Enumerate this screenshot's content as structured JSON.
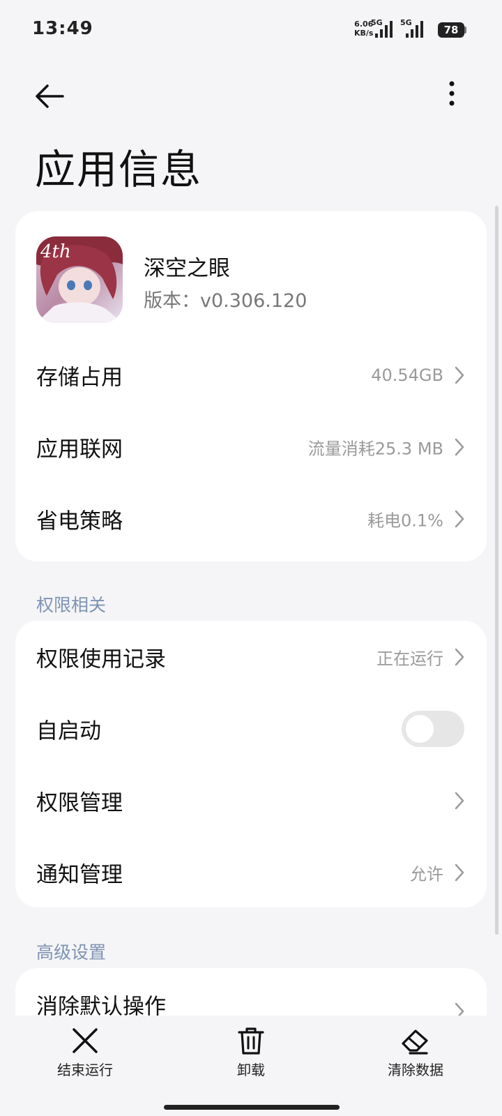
{
  "status_bar": {
    "time": "13:49",
    "net_speed_value": "6.06",
    "net_speed_unit": "KB/s",
    "sim1_label": "5G",
    "sim2_label": "5G",
    "battery": "78"
  },
  "header": {
    "title": "应用信息",
    "back_icon": "arrow-left-icon",
    "more_icon": "more-vertical-icon"
  },
  "app": {
    "name": "深空之眼",
    "version": "版本：v0.306.120",
    "icon_badge": "4th"
  },
  "info_rows": [
    {
      "label": "存储占用",
      "value": "40.54GB"
    },
    {
      "label": "应用联网",
      "value": "流量消耗25.3 MB"
    },
    {
      "label": "省电策略",
      "value": "耗电0.1%"
    }
  ],
  "permissions_section": {
    "title": "权限相关",
    "rows": [
      {
        "label": "权限使用记录",
        "value": "正在运行"
      },
      {
        "label": "自启动",
        "toggle_on": false
      },
      {
        "label": "权限管理",
        "value": ""
      },
      {
        "label": "通知管理",
        "value": "允许"
      }
    ]
  },
  "advanced_section": {
    "title": "高级设置",
    "rows": [
      {
        "label": "消除默认操作"
      }
    ]
  },
  "bottom_actions": [
    {
      "label": "结束运行",
      "icon": "close-icon"
    },
    {
      "label": "卸载",
      "icon": "trash-icon"
    },
    {
      "label": "清除数据",
      "icon": "eraser-icon"
    }
  ],
  "colors": {
    "background": "#f5f5f7",
    "card": "#ffffff",
    "section_header": "#7e93b3",
    "secondary_text": "#9a9a9a"
  }
}
